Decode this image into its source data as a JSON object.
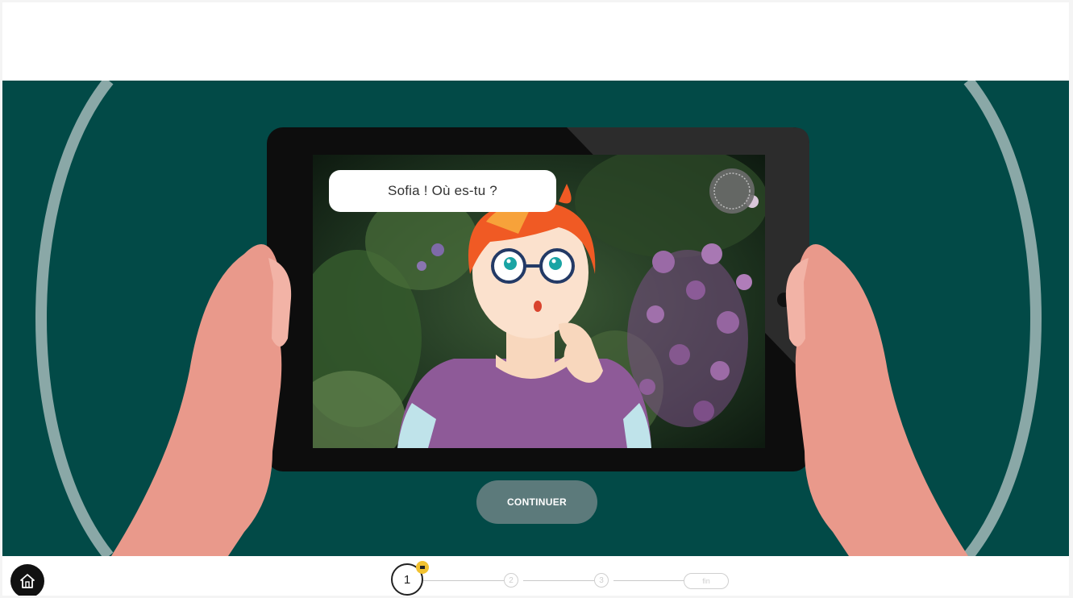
{
  "dialogue": {
    "speech_text": "Sofia ! Où es-tu ?"
  },
  "actions": {
    "continue_label": "CONTINUER"
  },
  "progress": {
    "steps": [
      {
        "label": "1",
        "state": "current"
      },
      {
        "label": "2",
        "state": "locked"
      },
      {
        "label": "3",
        "state": "locked"
      }
    ],
    "end_label": "fin"
  },
  "icons": {
    "home": "home-icon",
    "badge": "star-badge-icon",
    "stamp": "round-stamp-icon"
  },
  "colors": {
    "stage_background": "#024a47",
    "arc": "#8aa8a7",
    "button": "#5c7a7b",
    "skin": "#e9998b",
    "hair": "#f05a24",
    "shirt": "#8e5a98",
    "badge": "#f2c230"
  }
}
